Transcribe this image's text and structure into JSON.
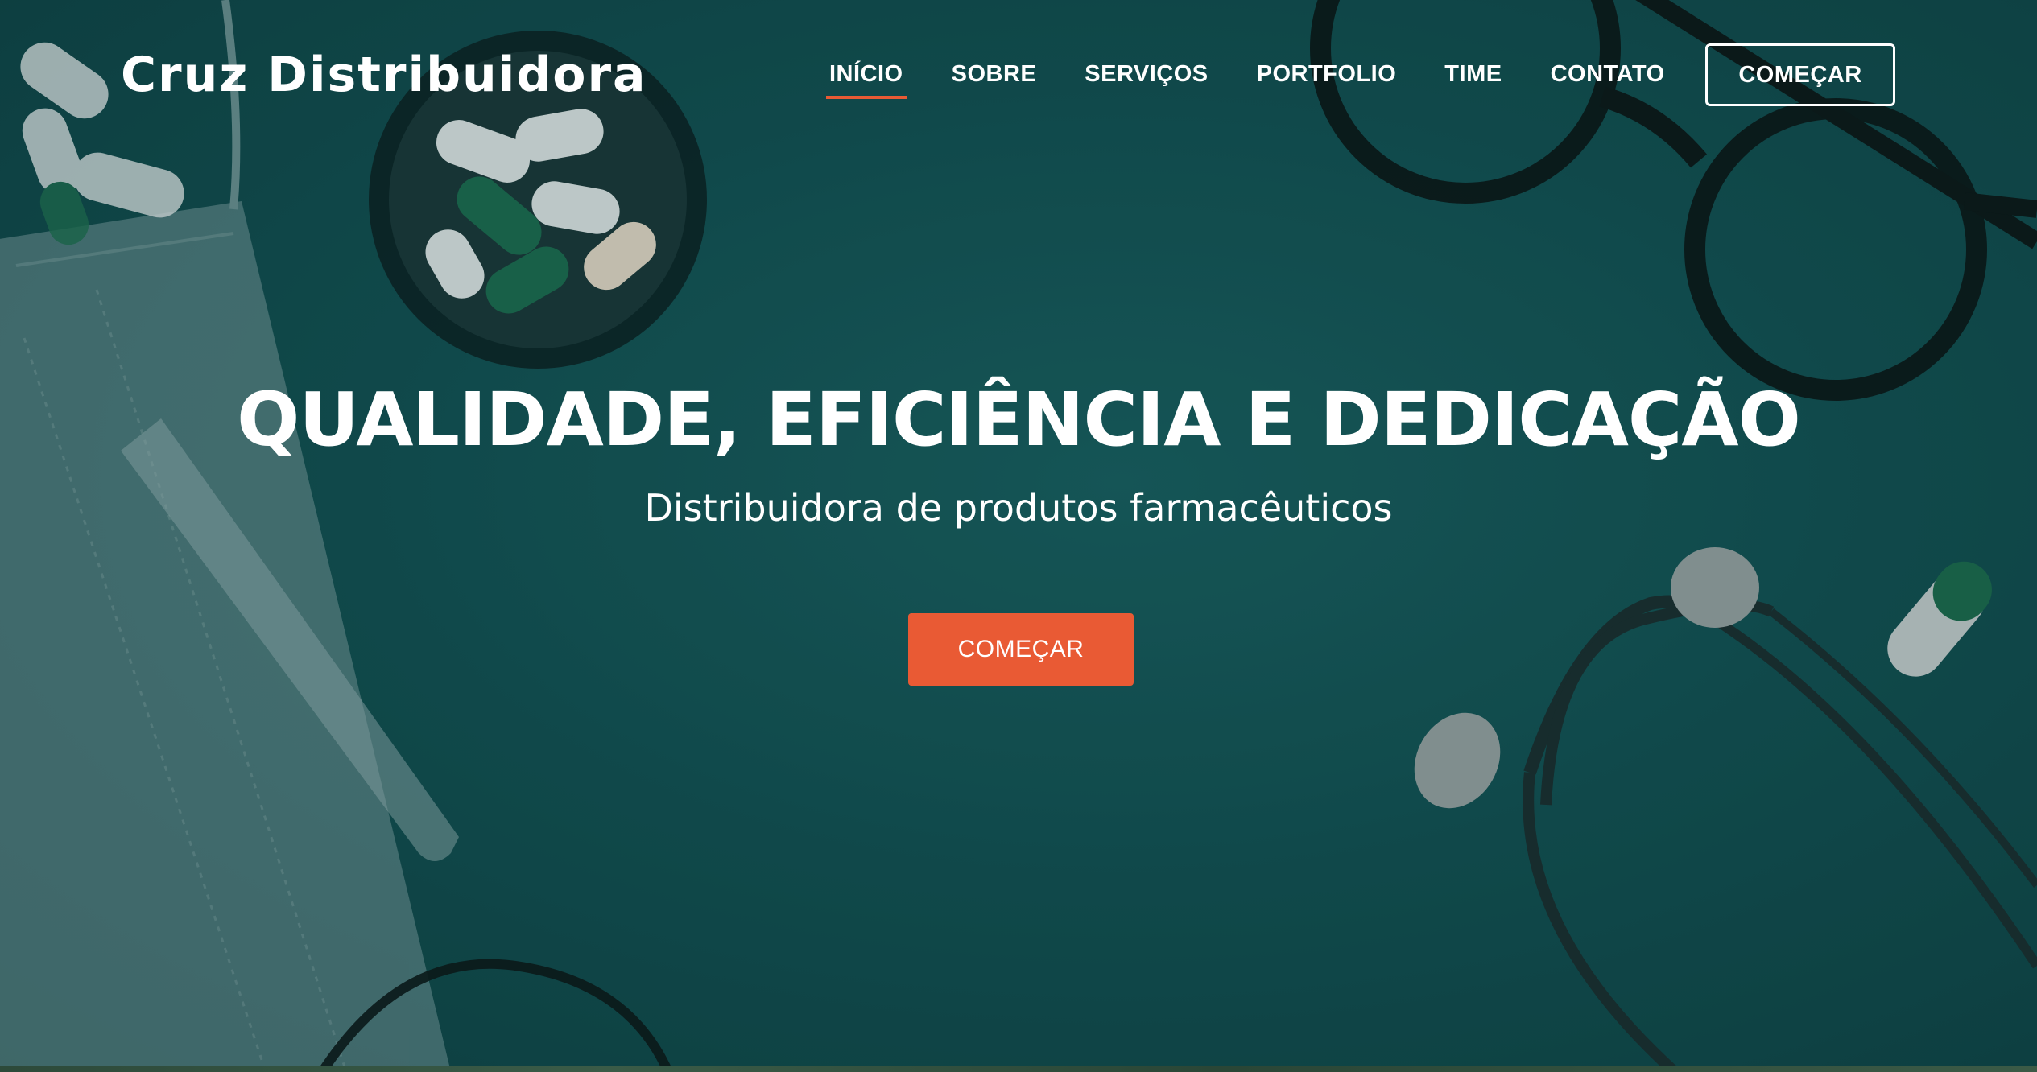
{
  "brand": {
    "name": "Cruz Distribuidora"
  },
  "nav": {
    "items": [
      {
        "label": "INÍCIO",
        "active": true
      },
      {
        "label": "SOBRE",
        "active": false
      },
      {
        "label": "SERVIÇOS",
        "active": false
      },
      {
        "label": "PORTFOLIO",
        "active": false
      },
      {
        "label": "TIME",
        "active": false
      },
      {
        "label": "CONTATO",
        "active": false
      }
    ],
    "cta_label": "COMEÇAR"
  },
  "hero": {
    "headline": "QUALIDADE, EFICIÊNCIA E DEDICAÇÃO",
    "subheadline": "Distribuidora de produtos farmacêuticos",
    "cta_label": "COMEÇAR"
  },
  "colors": {
    "background": "#124f51",
    "accent": "#e95a34",
    "text": "#ffffff"
  }
}
